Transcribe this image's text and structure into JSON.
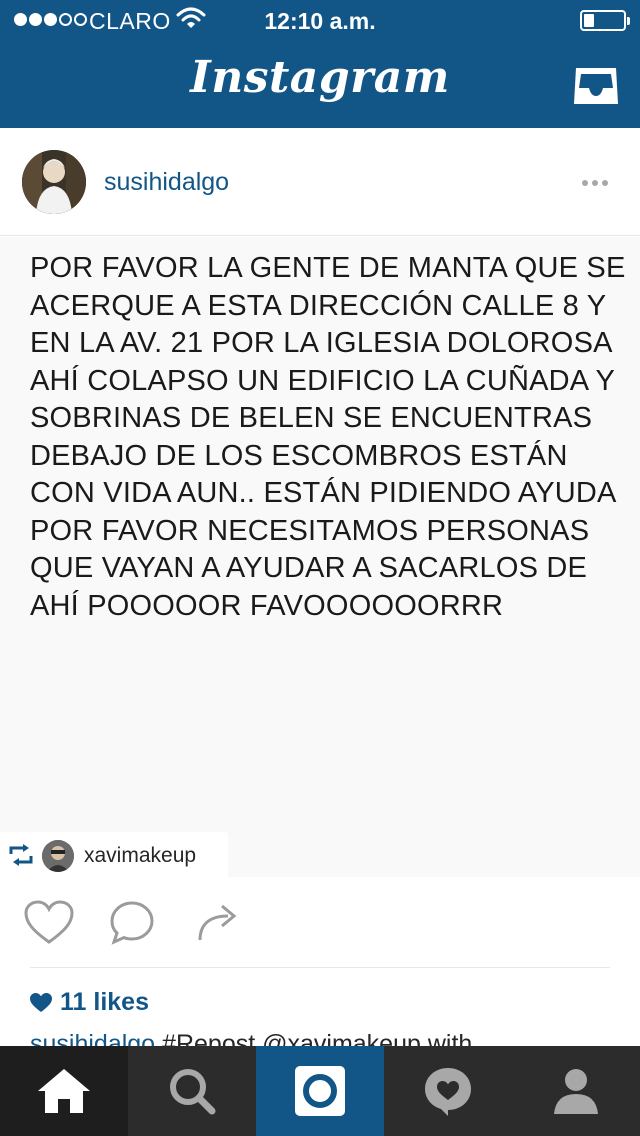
{
  "status_bar": {
    "carrier": "CLARO",
    "time": "12:10 a.m.",
    "signal_bars_filled": 3,
    "signal_bars_total": 5
  },
  "header": {
    "title": "Instagram",
    "inbox_icon": "inbox-tray-icon"
  },
  "post": {
    "username": "susihidalgo",
    "text": "POR FAVOR LA GENTE DE MANTA QUE SE ACERQUE A ESTA DIRECCIÓN CALLE 8 Y EN LA AV. 21 POR LA IGLESIA DOLOROSA AHÍ COLAPSO UN EDIFICIO LA CUÑADA Y SOBRINAS DE BELEN SE ENCUENTRAS DEBAJO DE LOS ESCOMBROS ESTÁN CON VIDA AUN.. ESTÁN PIDIENDO AYUDA POR FAVOR NECESITAMOS PERSONAS QUE VAYAN A AYUDAR A SACARLOS DE AHÍ POOOOOR FAVOOOOOORRR",
    "repost_user": "xavimakeup",
    "likes": "11 likes",
    "caption_user": "susihidalgo",
    "caption_text": "#Repost @xavimakeup with"
  },
  "tabbar": {
    "tabs": [
      {
        "icon": "home-icon"
      },
      {
        "icon": "search-icon"
      },
      {
        "icon": "camera-icon"
      },
      {
        "icon": "activity-heart-icon"
      },
      {
        "icon": "profile-icon"
      }
    ]
  },
  "colors": {
    "brand": "#125688",
    "tabbar": "#2c2c2c",
    "post_bg": "#f9f9f9"
  }
}
